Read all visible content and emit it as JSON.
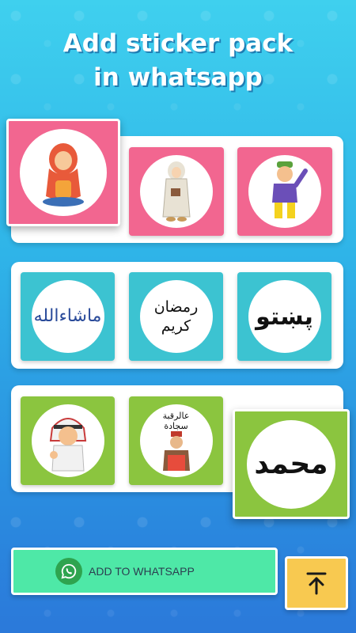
{
  "title": {
    "line1": "Add sticker pack",
    "line2": "in whatsapp"
  },
  "packs": [
    {
      "color": "#f26690",
      "stickers": [
        "girl-praying-sticker",
        "hijab-girl-sticker",
        "boy-waving-sticker"
      ]
    },
    {
      "color": "#3cc3d1",
      "stickers": [
        {
          "name": "mashallah-calligraphy-sticker",
          "text": "ماشاءالله"
        },
        {
          "name": "ramadan-kareem-calligraphy-sticker",
          "text": "رمضان كريم"
        },
        {
          "name": "pashto-calligraphy-sticker",
          "text": "پښتو"
        }
      ]
    },
    {
      "color": "#8bc53f",
      "stickers": [
        {
          "name": "arab-boy-sticker"
        },
        {
          "name": "man-with-sign-sticker",
          "text": "عالرقبة سجادة"
        },
        {
          "name": "muhammad-calligraphy-sticker",
          "text": "محمد"
        }
      ]
    }
  ],
  "add_button": {
    "label": "ADD TO WHATSAPP",
    "icon": "whatsapp-icon"
  },
  "scroll_top_button": {
    "icon": "arrow-up-to-line-icon"
  }
}
